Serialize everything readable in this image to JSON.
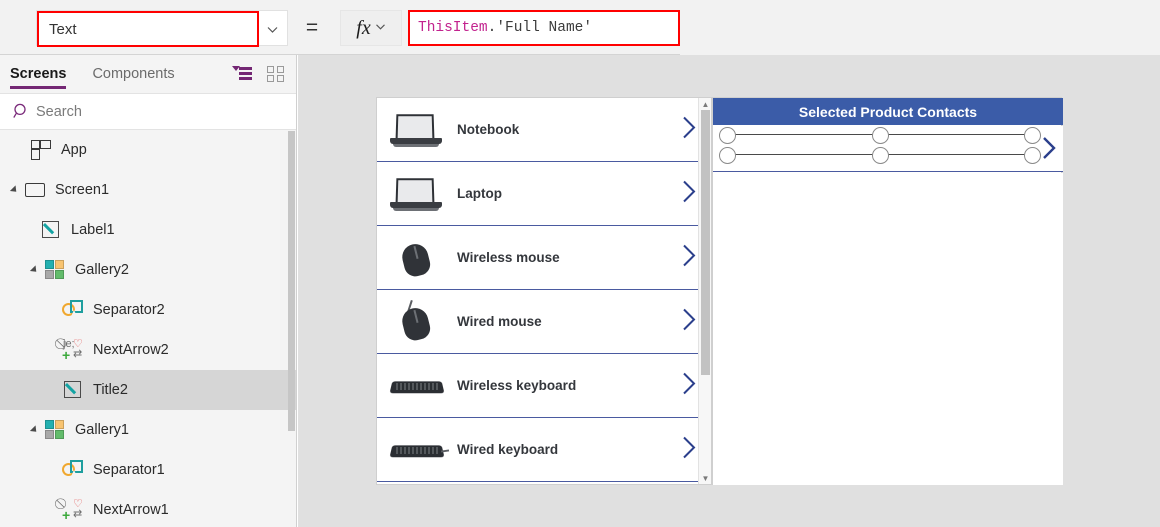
{
  "formula_bar": {
    "property_value": "Text",
    "property_chevron_icon": "chevron-down-icon",
    "equals": "=",
    "fx_label": "fx",
    "fx_chevron_icon": "chevron-down-icon",
    "formula_token_identifier": "ThisItem",
    "formula_token_rest": ".'Full Name'",
    "formula_full": "ThisItem.'Full Name'",
    "highlight_color": "#ff0000",
    "identifier_color": "#c2238e"
  },
  "sidebar": {
    "tabs": [
      {
        "label": "Screens",
        "active": true
      },
      {
        "label": "Components",
        "active": false
      }
    ],
    "accent_color": "#742774",
    "view_toggles": [
      {
        "icon": "tree-view-icon",
        "active": true
      },
      {
        "icon": "grid-view-icon",
        "active": false
      }
    ],
    "search": {
      "placeholder": "Search",
      "icon": "search-icon",
      "value": ""
    },
    "tree": [
      {
        "label": "App",
        "icon": "app-icon",
        "depth": 0,
        "caret": "none",
        "selected": false
      },
      {
        "label": "Screen1",
        "icon": "screen-icon",
        "depth": 0,
        "caret": "expanded",
        "selected": false
      },
      {
        "label": "Label1",
        "icon": "label-icon",
        "depth": 1,
        "caret": "none",
        "selected": false
      },
      {
        "label": "Gallery2",
        "icon": "gallery-icon",
        "depth": 1,
        "caret": "expanded",
        "selected": false
      },
      {
        "label": "Separator2",
        "icon": "separator-icon",
        "depth": 2,
        "caret": "none",
        "selected": false
      },
      {
        "label": "NextArrow2",
        "icon": "nextarrow-icon",
        "depth": 2,
        "caret": "none",
        "selected": false
      },
      {
        "label": "Title2",
        "icon": "label-icon",
        "depth": 2,
        "caret": "none",
        "selected": true
      },
      {
        "label": "Gallery1",
        "icon": "gallery-icon",
        "depth": 1,
        "caret": "expanded",
        "selected": false
      },
      {
        "label": "Separator1",
        "icon": "separator-icon",
        "depth": 2,
        "caret": "none",
        "selected": false
      },
      {
        "label": "NextArrow1",
        "icon": "nextarrow-icon",
        "depth": 2,
        "caret": "none",
        "selected": false
      }
    ]
  },
  "canvas": {
    "background_color": "#e0e0e0",
    "gallery1": {
      "items": [
        {
          "title": "Notebook",
          "thumb": "laptop-image"
        },
        {
          "title": "Laptop",
          "thumb": "laptop-image"
        },
        {
          "title": "Wireless mouse",
          "thumb": "mouse-image"
        },
        {
          "title": "Wired mouse",
          "thumb": "mouse-image"
        },
        {
          "title": "Wireless keyboard",
          "thumb": "keyboard-image"
        },
        {
          "title": "Wired keyboard",
          "thumb": "keyboard-image"
        }
      ],
      "chevron_icon": "chevron-right-icon",
      "separator_color": "#4a5aa0",
      "scrollbar": {
        "up_icon": "caret-up-icon",
        "down_icon": "caret-down-icon"
      }
    },
    "gallery2": {
      "header_title": "Selected Product Contacts",
      "header_color": "#3b5ca8",
      "selected_item_chevron_icon": "chevron-right-icon",
      "selection_handles": 6
    }
  }
}
